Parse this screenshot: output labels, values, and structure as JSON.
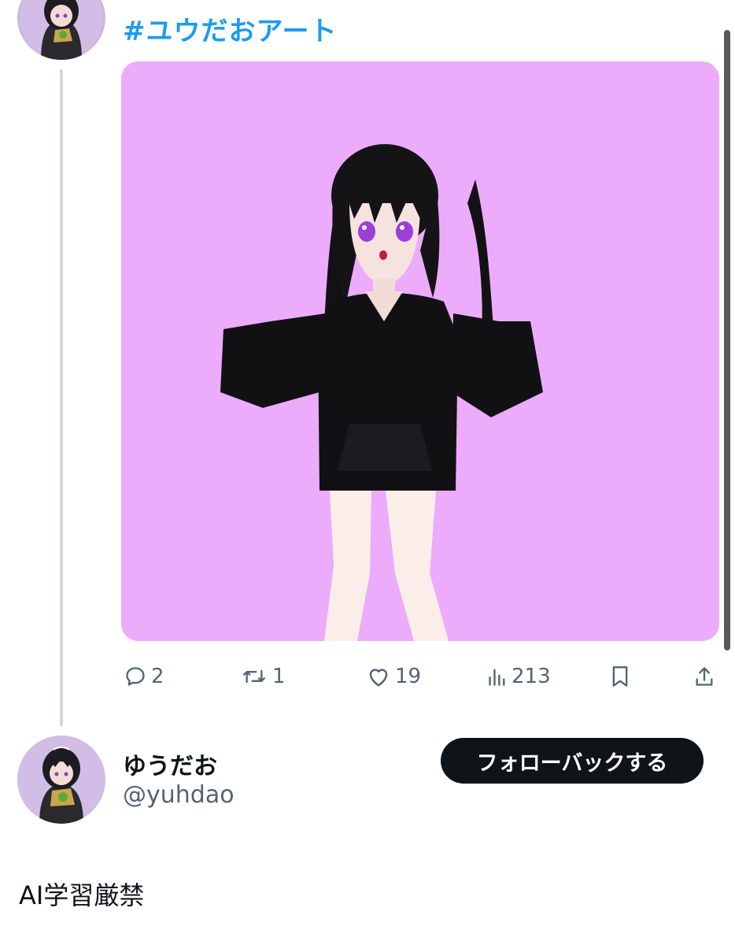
{
  "tweet": {
    "hashtag": "#ユウだおアート",
    "actions": {
      "replies": "2",
      "retweets": "1",
      "likes": "19",
      "views": "213"
    }
  },
  "user": {
    "display_name": "ゆうだお",
    "handle": "@yuhdao",
    "follow_back_label": "フォローバックする",
    "bio": "AI学習厳禁"
  },
  "colors": {
    "accent": "#1d9bf0",
    "media_background": "#edabfb",
    "muted_text": "#536471",
    "button_background": "#0f1419"
  },
  "icons": [
    "reply-icon",
    "retweet-icon",
    "like-icon",
    "views-icon",
    "bookmark-icon",
    "share-icon"
  ]
}
